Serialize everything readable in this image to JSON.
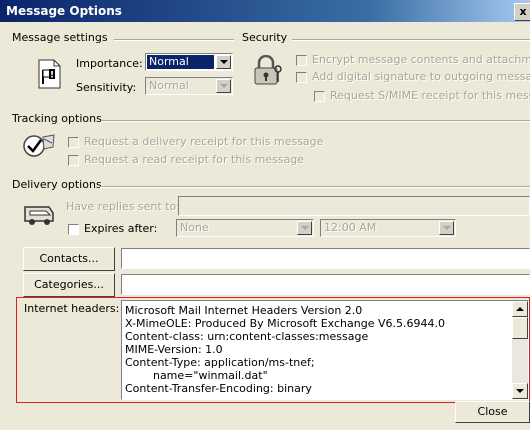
{
  "window": {
    "title": "Message Options",
    "close_glyph": "x"
  },
  "message_settings": {
    "legend": "Message settings",
    "importance_label": "Importance:",
    "importance_value": "Normal",
    "sensitivity_label": "Sensitivity:",
    "sensitivity_value": "Normal"
  },
  "security": {
    "legend": "Security",
    "encrypt": "Encrypt message contents and attachments",
    "signature": "Add digital signature to outgoing message",
    "smime_receipt": "Request S/MIME receipt for this message"
  },
  "tracking": {
    "legend": "Tracking options",
    "delivery_receipt": "Request a delivery receipt for this message",
    "read_receipt": "Request a read receipt for this message"
  },
  "delivery": {
    "legend": "Delivery options",
    "replies_label": "Have replies sent to:",
    "expires_label": "Expires after:",
    "expires_date": "None",
    "expires_time": "12:00 AM"
  },
  "buttons": {
    "contacts": "Contacts...",
    "categories": "Categories...",
    "close": "Close"
  },
  "internet_headers": {
    "label": "Internet headers:",
    "lines": [
      "Microsoft Mail Internet Headers Version 2.0",
      "X-MimeOLE: Produced By Microsoft Exchange V6.5.6944.0",
      "Content-class: urn:content-classes:message",
      "MIME-Version: 1.0",
      "Content-Type: application/ms-tnef;",
      "        name=\"winmail.dat\"",
      "Content-Transfer-Encoding: binary"
    ]
  },
  "icons": {
    "message_settings": "flag-document-icon",
    "security": "lock-key-icon",
    "tracking": "checkmark-envelope-icon",
    "delivery": "delivery-truck-icon"
  }
}
